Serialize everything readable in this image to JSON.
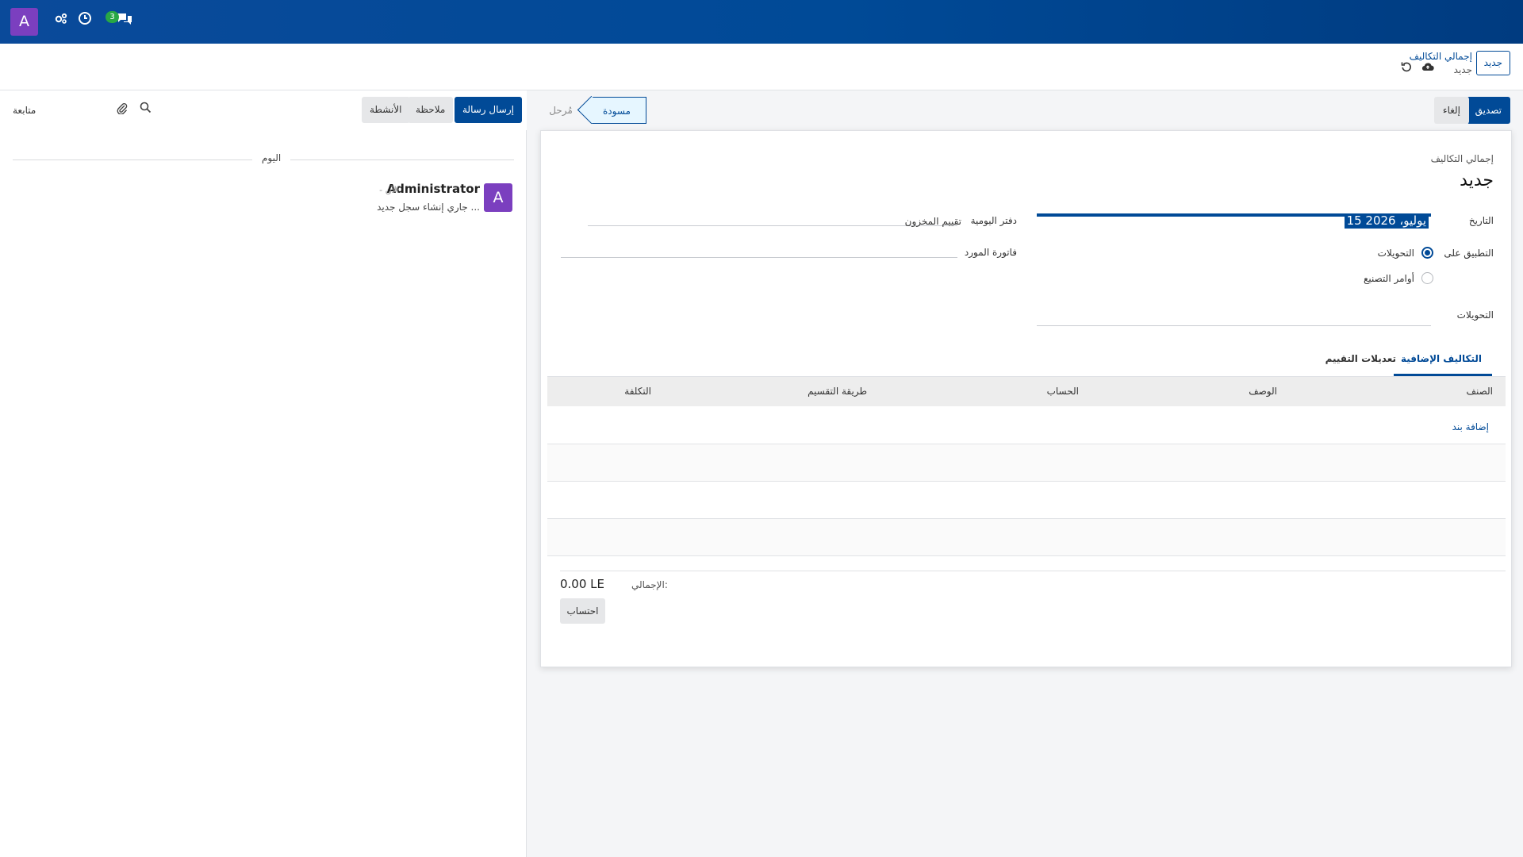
{
  "navbar": {
    "avatar_letter": "A",
    "badge_count": "3"
  },
  "control_panel": {
    "new_button": "جديد",
    "breadcrumb_parent": "إجمالي التكاليف",
    "breadcrumb_current": "جديد"
  },
  "form": {
    "buttons": {
      "validate": "تصديق",
      "cancel": "إلغاء"
    },
    "statusbar": {
      "posted": "مُرحل",
      "draft": "مسودة"
    },
    "sheet_label": "إجمالي التكاليف",
    "title": "جديد",
    "fields": {
      "date_label": "التاريخ",
      "date_value": "15 يوليو، 2026",
      "journal_label": "دفتر اليومية",
      "journal_value": "تقييم المخزون",
      "vendor_bill_label": "فاتورة المورد",
      "apply_on_label": "التطبيق على",
      "apply_on_options": [
        "التحويلات",
        "أوامر التصنيع"
      ],
      "transfers_label": "التحويلات"
    },
    "tabs": [
      "التكاليف الإضافية",
      "تعديلات التقييم"
    ],
    "table": {
      "columns": [
        "الصنف",
        "الوصف",
        "الحساب",
        "طريقة التقسيم",
        "التكلفة"
      ],
      "add_line": "إضافة بند"
    },
    "total_label": "الإجمالي:",
    "total_value": "0.00 LE",
    "compute_button": "احتساب"
  },
  "chatter": {
    "send_message": "إرسال رسالة",
    "log_note": "ملاحظة",
    "activities": "الأنشطة",
    "follow": "متابعة",
    "day_label": "اليوم",
    "message": {
      "avatar_letter": "A",
      "author": "Administrator",
      "time": "- الآن",
      "body": "جاري إنشاء سجل جديد ..."
    }
  },
  "colors": {
    "primary": "#014a97",
    "avatar": "#7b3fbf",
    "badge": "#28a745"
  }
}
